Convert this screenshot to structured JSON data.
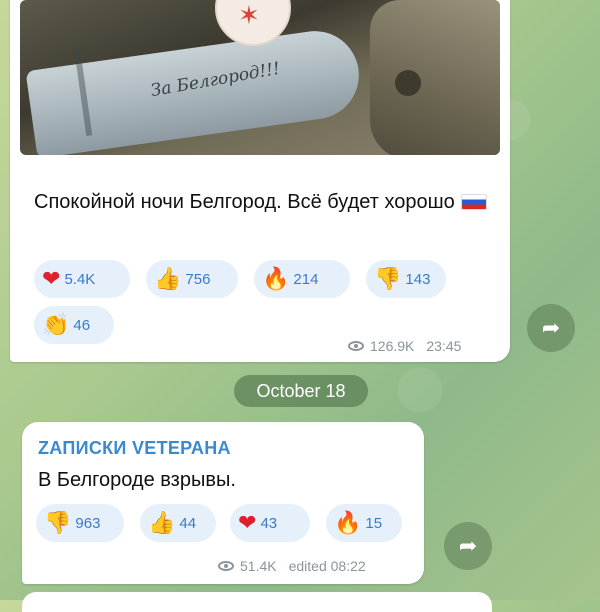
{
  "messages": [
    {
      "photo": {
        "shell_writing": "За Белгород!!!"
      },
      "text": "Спокойной ночи Белгород. Всё будет хорошо",
      "flag_icon": "russia-flag-icon",
      "reactions": [
        {
          "emoji": "❤",
          "icon": "red-heart-icon",
          "count": "5.4K"
        },
        {
          "emoji": "👍",
          "icon": "thumbs-up-icon",
          "count": "756"
        },
        {
          "emoji": "🔥",
          "icon": "fire-icon",
          "count": "214"
        },
        {
          "emoji": "👎",
          "icon": "thumbs-down-icon",
          "count": "143"
        },
        {
          "emoji": "👏",
          "icon": "clapping-hands-icon",
          "count": "46"
        }
      ],
      "views": "126.9K",
      "time": "23:45"
    },
    {
      "channel": "ZАПИСКИ VЕТЕРАНА",
      "text": "В Белгороде взрывы.",
      "reactions": [
        {
          "emoji": "👎",
          "icon": "thumbs-down-icon",
          "count": "963"
        },
        {
          "emoji": "👍",
          "icon": "thumbs-up-icon",
          "count": "44"
        },
        {
          "emoji": "❤",
          "icon": "red-heart-icon",
          "count": "43"
        },
        {
          "emoji": "🔥",
          "icon": "fire-icon",
          "count": "15"
        }
      ],
      "views": "51.4K",
      "time": "edited 08:22"
    }
  ],
  "date_separator": "October 18",
  "forward_glyph": "➦",
  "colors": {
    "link": "#3b8ad0",
    "reaction_bg": "#e6f0fa",
    "reaction_text": "#3a7bc8",
    "meta_text": "#8a949c"
  }
}
